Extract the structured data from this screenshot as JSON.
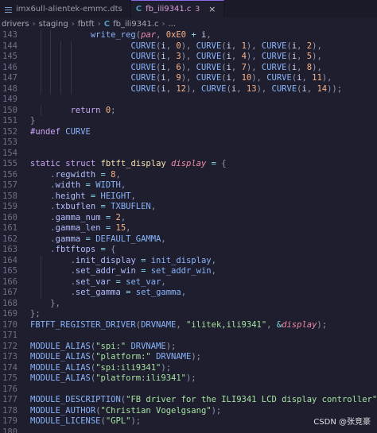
{
  "tabs": [
    {
      "label": "imx6ull-alientek-emmc.dts",
      "icon": "list-icon",
      "active": false
    },
    {
      "label": "fb_ili9341.c",
      "icon": "c-file-icon",
      "active": true,
      "badge": "3"
    }
  ],
  "breadcrumb": [
    "drivers",
    "staging",
    "fbtft",
    "C",
    "fb_ili9341.c",
    "..."
  ],
  "code_lines": [
    {
      "n": "143",
      "indent": 6,
      "tokens": [
        [
          "fn",
          "write_reg"
        ],
        [
          "punct",
          "("
        ],
        [
          "var",
          "par"
        ],
        [
          "punct",
          ", "
        ],
        [
          "num",
          "0xE0"
        ],
        [
          "op",
          " + "
        ],
        [
          "txt",
          "i"
        ],
        [
          "punct",
          ","
        ]
      ]
    },
    {
      "n": "144",
      "indent": 10,
      "tokens": [
        [
          "macro",
          "CURVE"
        ],
        [
          "punct",
          "("
        ],
        [
          "txt",
          "i"
        ],
        [
          "punct",
          ", "
        ],
        [
          "num",
          "0"
        ],
        [
          "punct",
          "), "
        ],
        [
          "macro",
          "CURVE"
        ],
        [
          "punct",
          "("
        ],
        [
          "txt",
          "i"
        ],
        [
          "punct",
          ", "
        ],
        [
          "num",
          "1"
        ],
        [
          "punct",
          "), "
        ],
        [
          "macro",
          "CURVE"
        ],
        [
          "punct",
          "("
        ],
        [
          "txt",
          "i"
        ],
        [
          "punct",
          ", "
        ],
        [
          "num",
          "2"
        ],
        [
          "punct",
          "),"
        ]
      ]
    },
    {
      "n": "145",
      "indent": 10,
      "tokens": [
        [
          "macro",
          "CURVE"
        ],
        [
          "punct",
          "("
        ],
        [
          "txt",
          "i"
        ],
        [
          "punct",
          ", "
        ],
        [
          "num",
          "3"
        ],
        [
          "punct",
          "), "
        ],
        [
          "macro",
          "CURVE"
        ],
        [
          "punct",
          "("
        ],
        [
          "txt",
          "i"
        ],
        [
          "punct",
          ", "
        ],
        [
          "num",
          "4"
        ],
        [
          "punct",
          "), "
        ],
        [
          "macro",
          "CURVE"
        ],
        [
          "punct",
          "("
        ],
        [
          "txt",
          "i"
        ],
        [
          "punct",
          ", "
        ],
        [
          "num",
          "5"
        ],
        [
          "punct",
          "),"
        ]
      ]
    },
    {
      "n": "146",
      "indent": 10,
      "tokens": [
        [
          "macro",
          "CURVE"
        ],
        [
          "punct",
          "("
        ],
        [
          "txt",
          "i"
        ],
        [
          "punct",
          ", "
        ],
        [
          "num",
          "6"
        ],
        [
          "punct",
          "), "
        ],
        [
          "macro",
          "CURVE"
        ],
        [
          "punct",
          "("
        ],
        [
          "txt",
          "i"
        ],
        [
          "punct",
          ", "
        ],
        [
          "num",
          "7"
        ],
        [
          "punct",
          "), "
        ],
        [
          "macro",
          "CURVE"
        ],
        [
          "punct",
          "("
        ],
        [
          "txt",
          "i"
        ],
        [
          "punct",
          ", "
        ],
        [
          "num",
          "8"
        ],
        [
          "punct",
          "),"
        ]
      ]
    },
    {
      "n": "147",
      "indent": 10,
      "tokens": [
        [
          "macro",
          "CURVE"
        ],
        [
          "punct",
          "("
        ],
        [
          "txt",
          "i"
        ],
        [
          "punct",
          ", "
        ],
        [
          "num",
          "9"
        ],
        [
          "punct",
          "), "
        ],
        [
          "macro",
          "CURVE"
        ],
        [
          "punct",
          "("
        ],
        [
          "txt",
          "i"
        ],
        [
          "punct",
          ", "
        ],
        [
          "num",
          "10"
        ],
        [
          "punct",
          "), "
        ],
        [
          "macro",
          "CURVE"
        ],
        [
          "punct",
          "("
        ],
        [
          "txt",
          "i"
        ],
        [
          "punct",
          ", "
        ],
        [
          "num",
          "11"
        ],
        [
          "punct",
          "),"
        ]
      ]
    },
    {
      "n": "148",
      "indent": 10,
      "tokens": [
        [
          "macro",
          "CURVE"
        ],
        [
          "punct",
          "("
        ],
        [
          "txt",
          "i"
        ],
        [
          "punct",
          ", "
        ],
        [
          "num",
          "12"
        ],
        [
          "punct",
          "), "
        ],
        [
          "macro",
          "CURVE"
        ],
        [
          "punct",
          "("
        ],
        [
          "txt",
          "i"
        ],
        [
          "punct",
          ", "
        ],
        [
          "num",
          "13"
        ],
        [
          "punct",
          "), "
        ],
        [
          "macro",
          "CURVE"
        ],
        [
          "punct",
          "("
        ],
        [
          "txt",
          "i"
        ],
        [
          "punct",
          ", "
        ],
        [
          "num",
          "14"
        ],
        [
          "punct",
          "));"
        ]
      ]
    },
    {
      "n": "149",
      "indent": 0,
      "tokens": []
    },
    {
      "n": "150",
      "indent": 4,
      "tokens": [
        [
          "kw",
          "return"
        ],
        [
          "txt",
          " "
        ],
        [
          "num",
          "0"
        ],
        [
          "punct",
          ";"
        ]
      ]
    },
    {
      "n": "151",
      "indent": 0,
      "tokens": [
        [
          "punct",
          "}"
        ]
      ]
    },
    {
      "n": "152",
      "indent": 0,
      "tokens": [
        [
          "kw",
          "#undef"
        ],
        [
          "txt",
          " "
        ],
        [
          "macro",
          "CURVE"
        ]
      ]
    },
    {
      "n": "153",
      "indent": 0,
      "tokens": []
    },
    {
      "n": "154",
      "indent": 0,
      "tokens": []
    },
    {
      "n": "155",
      "indent": 0,
      "tokens": [
        [
          "kw",
          "static"
        ],
        [
          "txt",
          " "
        ],
        [
          "kw",
          "struct"
        ],
        [
          "txt",
          " "
        ],
        [
          "name",
          "fbtft_display"
        ],
        [
          "txt",
          " "
        ],
        [
          "var",
          "display"
        ],
        [
          "op",
          " = "
        ],
        [
          "punct",
          "{"
        ]
      ]
    },
    {
      "n": "156",
      "indent": 2,
      "tokens": [
        [
          "punct",
          "."
        ],
        [
          "field",
          "regwidth"
        ],
        [
          "op",
          " = "
        ],
        [
          "num",
          "8"
        ],
        [
          "punct",
          ","
        ]
      ]
    },
    {
      "n": "157",
      "indent": 2,
      "tokens": [
        [
          "punct",
          "."
        ],
        [
          "field",
          "width"
        ],
        [
          "op",
          " = "
        ],
        [
          "macro",
          "WIDTH"
        ],
        [
          "punct",
          ","
        ]
      ]
    },
    {
      "n": "158",
      "indent": 2,
      "tokens": [
        [
          "punct",
          "."
        ],
        [
          "field",
          "height"
        ],
        [
          "op",
          " = "
        ],
        [
          "macro",
          "HEIGHT"
        ],
        [
          "punct",
          ","
        ]
      ]
    },
    {
      "n": "159",
      "indent": 2,
      "tokens": [
        [
          "punct",
          "."
        ],
        [
          "field",
          "txbuflen"
        ],
        [
          "op",
          " = "
        ],
        [
          "macro",
          "TXBUFLEN"
        ],
        [
          "punct",
          ","
        ]
      ]
    },
    {
      "n": "160",
      "indent": 2,
      "tokens": [
        [
          "punct",
          "."
        ],
        [
          "field",
          "gamma_num"
        ],
        [
          "op",
          " = "
        ],
        [
          "num",
          "2"
        ],
        [
          "punct",
          ","
        ]
      ]
    },
    {
      "n": "161",
      "indent": 2,
      "tokens": [
        [
          "punct",
          "."
        ],
        [
          "field",
          "gamma_len"
        ],
        [
          "op",
          " = "
        ],
        [
          "num",
          "15"
        ],
        [
          "punct",
          ","
        ]
      ]
    },
    {
      "n": "162",
      "indent": 2,
      "tokens": [
        [
          "punct",
          "."
        ],
        [
          "field",
          "gamma"
        ],
        [
          "op",
          " = "
        ],
        [
          "macro",
          "DEFAULT_GAMMA"
        ],
        [
          "punct",
          ","
        ]
      ]
    },
    {
      "n": "163",
      "indent": 2,
      "tokens": [
        [
          "punct",
          "."
        ],
        [
          "field",
          "fbtftops"
        ],
        [
          "op",
          " = "
        ],
        [
          "punct",
          "{"
        ]
      ]
    },
    {
      "n": "164",
      "indent": 4,
      "tokens": [
        [
          "punct",
          "."
        ],
        [
          "field",
          "init_display"
        ],
        [
          "op",
          " = "
        ],
        [
          "fn",
          "init_display"
        ],
        [
          "punct",
          ","
        ]
      ]
    },
    {
      "n": "165",
      "indent": 4,
      "tokens": [
        [
          "punct",
          "."
        ],
        [
          "field",
          "set_addr_win"
        ],
        [
          "op",
          " = "
        ],
        [
          "fn",
          "set_addr_win"
        ],
        [
          "punct",
          ","
        ]
      ]
    },
    {
      "n": "166",
      "indent": 4,
      "tokens": [
        [
          "punct",
          "."
        ],
        [
          "field",
          "set_var"
        ],
        [
          "op",
          " = "
        ],
        [
          "fn",
          "set_var"
        ],
        [
          "punct",
          ","
        ]
      ]
    },
    {
      "n": "167",
      "indent": 4,
      "tokens": [
        [
          "punct",
          "."
        ],
        [
          "field",
          "set_gamma"
        ],
        [
          "op",
          " = "
        ],
        [
          "fn",
          "set_gamma"
        ],
        [
          "punct",
          ","
        ]
      ]
    },
    {
      "n": "168",
      "indent": 2,
      "tokens": [
        [
          "punct",
          "},"
        ]
      ]
    },
    {
      "n": "169",
      "indent": 0,
      "tokens": [
        [
          "punct",
          "};"
        ]
      ]
    },
    {
      "n": "170",
      "indent": 0,
      "tokens": [
        [
          "macro",
          "FBTFT_REGISTER_DRIVER"
        ],
        [
          "punct",
          "("
        ],
        [
          "macro",
          "DRVNAME"
        ],
        [
          "punct",
          ", "
        ],
        [
          "str",
          "\"ilitek,ili9341\""
        ],
        [
          "punct",
          ", "
        ],
        [
          "op",
          "&"
        ],
        [
          "var",
          "display"
        ],
        [
          "punct",
          ");"
        ]
      ]
    },
    {
      "n": "171",
      "indent": 0,
      "tokens": []
    },
    {
      "n": "172",
      "indent": 0,
      "tokens": [
        [
          "macro",
          "MODULE_ALIAS"
        ],
        [
          "punct",
          "("
        ],
        [
          "str",
          "\"spi:\""
        ],
        [
          "txt",
          " "
        ],
        [
          "macro",
          "DRVNAME"
        ],
        [
          "punct",
          ");"
        ]
      ]
    },
    {
      "n": "173",
      "indent": 0,
      "tokens": [
        [
          "macro",
          "MODULE_ALIAS"
        ],
        [
          "punct",
          "("
        ],
        [
          "str",
          "\"platform:\""
        ],
        [
          "txt",
          " "
        ],
        [
          "macro",
          "DRVNAME"
        ],
        [
          "punct",
          ");"
        ]
      ]
    },
    {
      "n": "174",
      "indent": 0,
      "tokens": [
        [
          "macro",
          "MODULE_ALIAS"
        ],
        [
          "punct",
          "("
        ],
        [
          "str",
          "\"spi:ili9341\""
        ],
        [
          "punct",
          ");"
        ]
      ]
    },
    {
      "n": "175",
      "indent": 0,
      "tokens": [
        [
          "macro",
          "MODULE_ALIAS"
        ],
        [
          "punct",
          "("
        ],
        [
          "str",
          "\"platform:ili9341\""
        ],
        [
          "punct",
          ");"
        ]
      ]
    },
    {
      "n": "176",
      "indent": 0,
      "tokens": []
    },
    {
      "n": "177",
      "indent": 0,
      "tokens": [
        [
          "macro",
          "MODULE_DESCRIPTION"
        ],
        [
          "punct",
          "("
        ],
        [
          "str",
          "\"FB driver for the ILI9341 LCD display controller\""
        ],
        [
          "punct",
          ");"
        ]
      ]
    },
    {
      "n": "178",
      "indent": 0,
      "tokens": [
        [
          "macro",
          "MODULE_AUTHOR"
        ],
        [
          "punct",
          "("
        ],
        [
          "str",
          "\"Christian Vogelgsang\""
        ],
        [
          "punct",
          ");"
        ]
      ]
    },
    {
      "n": "179",
      "indent": 0,
      "tokens": [
        [
          "macro",
          "MODULE_LICENSE"
        ],
        [
          "punct",
          "("
        ],
        [
          "str",
          "\"GPL\""
        ],
        [
          "punct",
          ");"
        ]
      ]
    },
    {
      "n": "180",
      "indent": 0,
      "tokens": []
    }
  ],
  "watermark": "CSDN @张竞豪"
}
